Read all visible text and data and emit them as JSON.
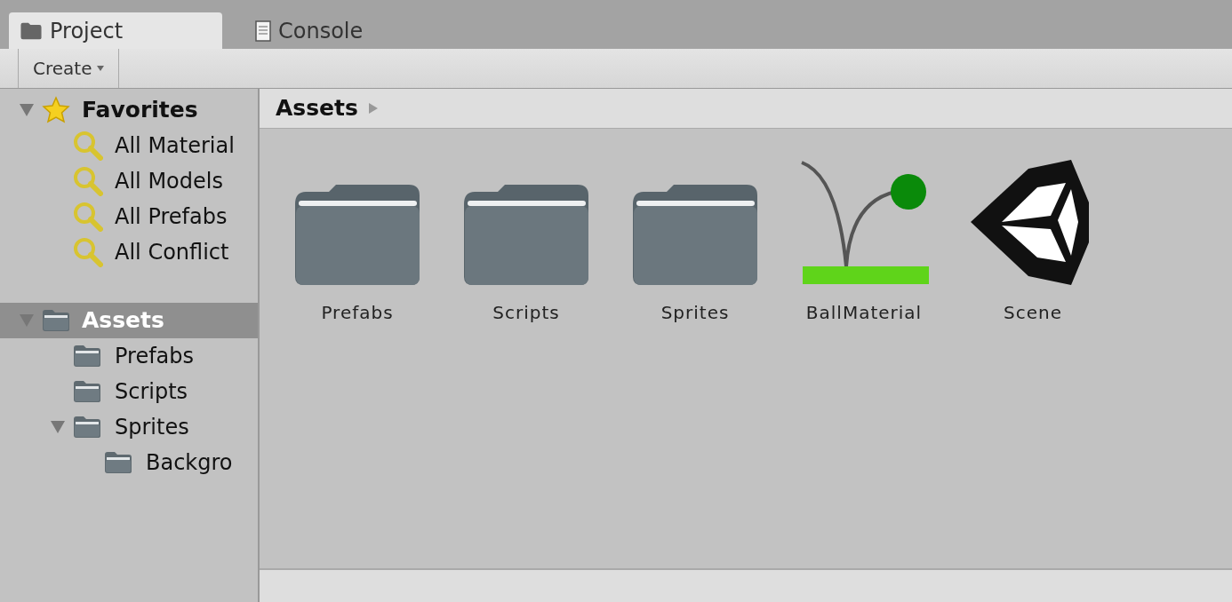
{
  "tabs": [
    {
      "label": "Project",
      "kind": "folder",
      "selected": true
    },
    {
      "label": "Console",
      "kind": "console",
      "selected": false
    }
  ],
  "toolbar": {
    "create_button": "Create"
  },
  "sidebar": [
    {
      "label": "Favorites",
      "kind": "star",
      "expanded": true,
      "selected": false,
      "children": [
        {
          "label": "All Material",
          "kind": "search"
        },
        {
          "label": "All Models",
          "kind": "search"
        },
        {
          "label": "All Prefabs",
          "kind": "search"
        },
        {
          "label": "All Conflict",
          "kind": "search"
        }
      ]
    },
    {
      "label": "Assets",
      "kind": "folder",
      "expanded": true,
      "selected": true,
      "children": [
        {
          "label": "Prefabs",
          "kind": "folder"
        },
        {
          "label": "Scripts",
          "kind": "folder"
        },
        {
          "label": "Sprites",
          "kind": "folder",
          "expanded": true,
          "children": [
            {
              "label": "Backgro",
              "kind": "folder"
            }
          ]
        }
      ]
    }
  ],
  "breadcrumb": "Assets",
  "assets": [
    {
      "label": "Prefabs",
      "kind": "folder"
    },
    {
      "label": "Scripts",
      "kind": "folder"
    },
    {
      "label": "Sprites",
      "kind": "folder"
    },
    {
      "label": "BallMaterial",
      "kind": "material"
    },
    {
      "label": "Scene",
      "kind": "scene"
    }
  ]
}
